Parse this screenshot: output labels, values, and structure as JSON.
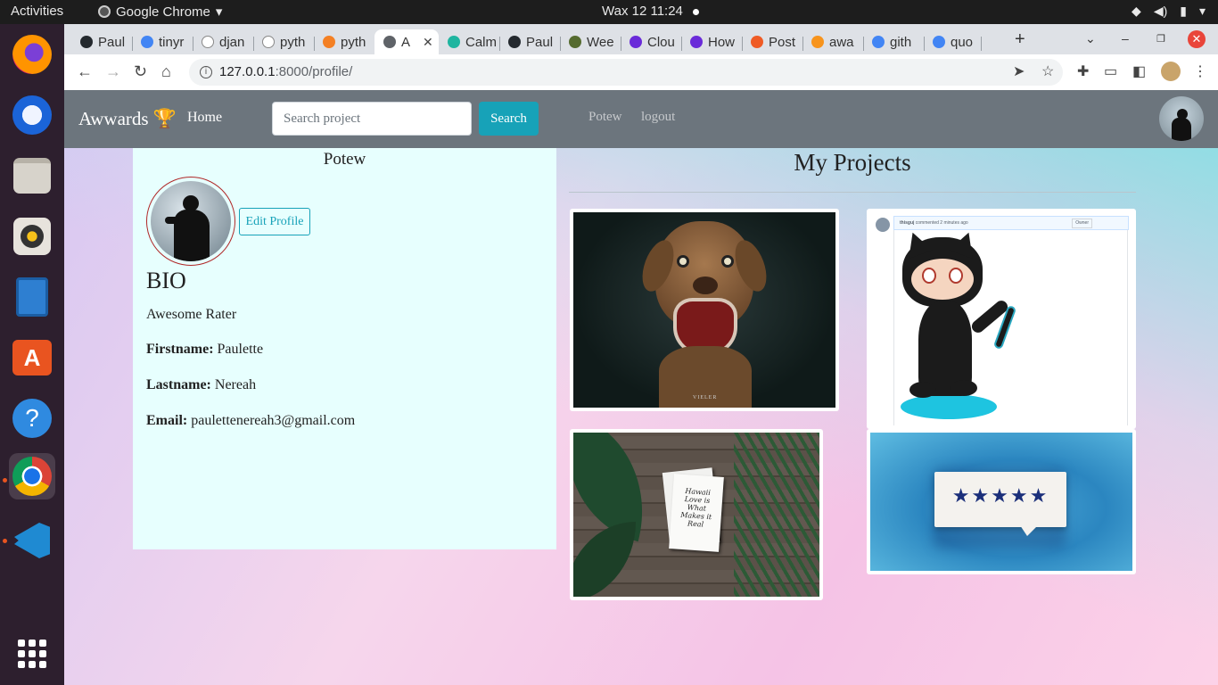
{
  "os": {
    "activities": "Activities",
    "app_name": "Google Chrome",
    "clock": "Wax 12  11:24"
  },
  "browser": {
    "tabs": [
      {
        "label": "Paul",
        "color": "#24292e"
      },
      {
        "label": "tinyr",
        "color": "#4285f4"
      },
      {
        "label": "djan",
        "color": "#ffffff"
      },
      {
        "label": "pyth",
        "color": "#ffffff"
      },
      {
        "label": "pyth",
        "color": "#f48024"
      },
      {
        "label": "A",
        "color": "#5f6368",
        "active": true
      },
      {
        "label": "Calm",
        "color": "#1fb5a0"
      },
      {
        "label": "Paul",
        "color": "#24292e"
      },
      {
        "label": "Wee",
        "color": "#556b2f"
      },
      {
        "label": "Clou",
        "color": "#6a2bd9"
      },
      {
        "label": "How",
        "color": "#6a2bd9"
      },
      {
        "label": "Post",
        "color": "#ef5b25"
      },
      {
        "label": "awa",
        "color": "#f7941d"
      },
      {
        "label": "gith",
        "color": "#4285f4"
      },
      {
        "label": "quo",
        "color": "#4285f4"
      }
    ],
    "url_host": "127.0.0.1",
    "url_path": ":8000/profile/"
  },
  "navbar": {
    "brand": "Awwards",
    "brand_icon": "🏆",
    "home": "Home",
    "search_placeholder": "Search project",
    "search_button": "Search",
    "username": "Potew",
    "logout": "logout"
  },
  "profile": {
    "username": "Potew",
    "edit_button": "Edit Profile",
    "bio_heading": "BIO",
    "bio": "Awesome Rater",
    "firstname_label": "Firstname:",
    "firstname": "Paulette",
    "lastname_label": "Lastname:",
    "lastname": "Nereah",
    "email_label": "Email:",
    "email": "paulettenereah3@gmail.com"
  },
  "projects": {
    "title": "My Projects",
    "github_comment_user": "thisguj",
    "github_comment_text": "commented 2 minutes ago",
    "github_comment_badge": "Owner",
    "dog_watermark": "VIELER",
    "card_text": "Hawaii Love is What Makes it Real",
    "stars": "★★★★★"
  },
  "colors": {
    "accent": "#17a2b8",
    "navbar": "#6c757d",
    "profile_bg": "#e7fffe"
  }
}
